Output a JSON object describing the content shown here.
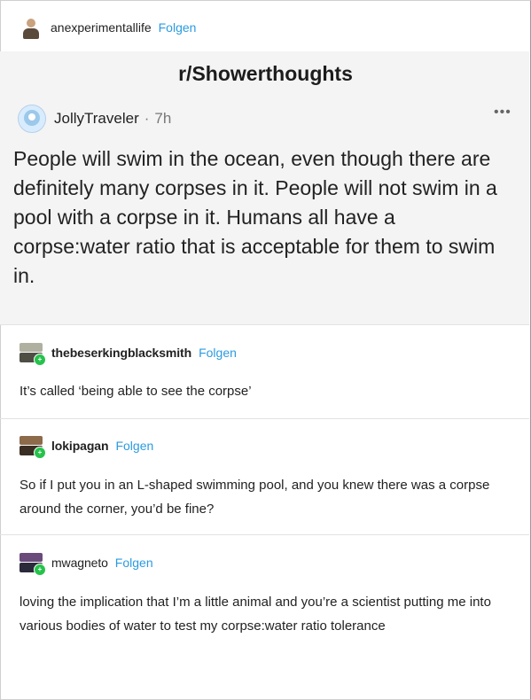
{
  "reblogger": {
    "username": "anexperimentallife",
    "follow_label": "Folgen"
  },
  "reddit_post": {
    "subreddit": "r/Showerthoughts",
    "username": "JollyTraveler",
    "separator": "·",
    "time": "7h",
    "more_icon": "•••",
    "text": "People will swim in the ocean, even though there are definitely many corpses in it. People will not swim in a pool with a corpse in it. Humans all have a corpse:water ratio that is acceptable for them to swim in."
  },
  "replies": [
    {
      "username": "thebeserkingblacksmith",
      "follow_label": "Folgen",
      "text": "It’s called ‘being able to see the corpse’"
    },
    {
      "username": "lokipagan",
      "follow_label": "Folgen",
      "text": "So if I put you in an L-shaped swimming pool, and you knew there was a corpse around the corner, you’d be fine?"
    },
    {
      "username": "mwagneto",
      "follow_label": "Folgen",
      "text": "loving the implication that I’m a little animal and you’re a scientist putting me into various bodies of water to test my corpse:water ratio tolerance"
    }
  ],
  "icons": {
    "reblogger_avatar": "avatar-icon",
    "reddit_avatar": "reddit-avatar-icon",
    "more": "more-icon",
    "badge": "add-badge-icon"
  },
  "colors": {
    "follow_link": "#2b9be0",
    "badge": "#27c24c",
    "reddit_background": "#f4f4f4"
  }
}
